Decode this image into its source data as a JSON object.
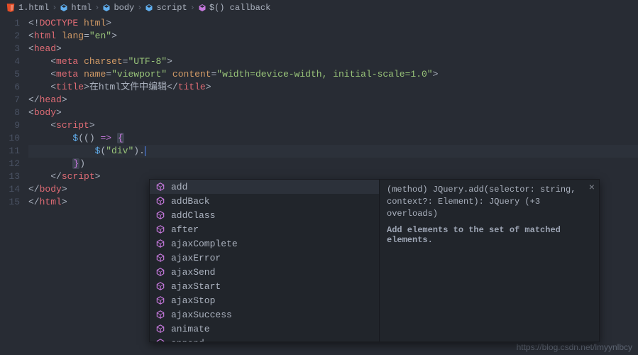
{
  "breadcrumb": [
    {
      "label": "1.html",
      "icon": "html"
    },
    {
      "label": "html",
      "icon": "cube"
    },
    {
      "label": "body",
      "icon": "cube"
    },
    {
      "label": "script",
      "icon": "cube"
    },
    {
      "label": "$() callback",
      "icon": "cube"
    }
  ],
  "lines": {
    "1": {
      "indent": 0,
      "html": "<span class='t-br'>&lt;!</span><span class='t-tag'>DOCTYPE</span> <span class='t-attr'>html</span><span class='t-br'>&gt;</span>",
      "raw": "<!DOCTYPE html>"
    },
    "2": {
      "indent": 0,
      "html": "<span class='t-br'>&lt;</span><span class='t-tag'>html</span> <span class='t-attr'>lang</span><span class='t-punc'>=</span><span class='t-str'>\"en\"</span><span class='t-br'>&gt;</span>",
      "raw": "<html lang=\"en\">"
    },
    "3": {
      "indent": 0,
      "html": "<span class='t-br'>&lt;</span><span class='t-tag'>head</span><span class='t-br'>&gt;</span>",
      "raw": "<head>"
    },
    "4": {
      "indent": 1,
      "html": "<span class='t-br'>&lt;</span><span class='t-tag'>meta</span> <span class='t-attr'>charset</span><span class='t-punc'>=</span><span class='t-str'>\"UTF-8\"</span><span class='t-br'>&gt;</span>",
      "raw": "<meta charset=\"UTF-8\">"
    },
    "5": {
      "indent": 1,
      "html": "<span class='t-br'>&lt;</span><span class='t-tag'>meta</span> <span class='t-attr'>name</span><span class='t-punc'>=</span><span class='t-str'>\"viewport\"</span> <span class='t-attr'>content</span><span class='t-punc'>=</span><span class='t-str'>\"width=device-width, initial-scale=1.0\"</span><span class='t-br'>&gt;</span>",
      "raw": "<meta name=\"viewport\" content=\"width=device-width, initial-scale=1.0\">"
    },
    "6": {
      "indent": 1,
      "html": "<span class='t-br'>&lt;</span><span class='t-tag'>title</span><span class='t-br'>&gt;</span><span class='t-text'>在html文件中编辑</span><span class='t-br'>&lt;/</span><span class='t-tag'>title</span><span class='t-br'>&gt;</span>",
      "raw": "<title>在html文件中编辑</title>"
    },
    "7": {
      "indent": 0,
      "html": "<span class='t-br'>&lt;/</span><span class='t-tag'>head</span><span class='t-br'>&gt;</span>",
      "raw": "</head>"
    },
    "8": {
      "indent": 0,
      "html": "<span class='t-br'>&lt;</span><span class='t-tag'>body</span><span class='t-br'>&gt;</span>",
      "raw": "<body>"
    },
    "9": {
      "indent": 1,
      "html": "<span class='t-br'>&lt;</span><span class='t-tag'>script</span><span class='t-br'>&gt;</span>",
      "raw": "<script>"
    },
    "10": {
      "indent": 2,
      "html": "<span class='t-name'>$</span><span class='t-punc'>(</span><span class='t-punc'>(</span><span class='t-punc'>)</span> <span class='t-kw'>=&gt;</span> <span class='hl-open t-brkt'>{</span>",
      "raw": "$(() => {"
    },
    "11": {
      "indent": 3,
      "html": "<span class='t-name'>$</span><span class='t-punc'>(</span><span class='t-str'>\"div\"</span><span class='t-punc'>)</span><span class='t-punc'>.</span><span class='t-cursor'></span>",
      "raw": "$(\"div\").",
      "active": true
    },
    "12": {
      "indent": 2,
      "html": "<span class='hl-open t-brkt'>}</span><span class='t-punc'>)</span>",
      "raw": "})"
    },
    "13": {
      "indent": 1,
      "html": "<span class='t-br'>&lt;/</span><span class='t-tag'>script</span><span class='t-br'>&gt;</span>",
      "raw": "</script>"
    },
    "14": {
      "indent": 0,
      "html": "<span class='t-br'>&lt;/</span><span class='t-tag'>body</span><span class='t-br'>&gt;</span>",
      "raw": "</body>"
    },
    "15": {
      "indent": 0,
      "html": "<span class='t-br'>&lt;/</span><span class='t-tag'>html</span><span class='t-br'>&gt;</span>",
      "raw": "</html>"
    }
  },
  "suggest": {
    "items": [
      "add",
      "addBack",
      "addClass",
      "after",
      "ajaxComplete",
      "ajaxError",
      "ajaxSend",
      "ajaxStart",
      "ajaxStop",
      "ajaxSuccess",
      "animate",
      "append"
    ],
    "selected": 0
  },
  "doc": {
    "signature": "(method) JQuery.add(selector: string, context?: Element): JQuery (+3 overloads)",
    "description": "Add elements to the set of matched elements."
  },
  "watermark": "https://blog.csdn.net/lmyynlbcy"
}
